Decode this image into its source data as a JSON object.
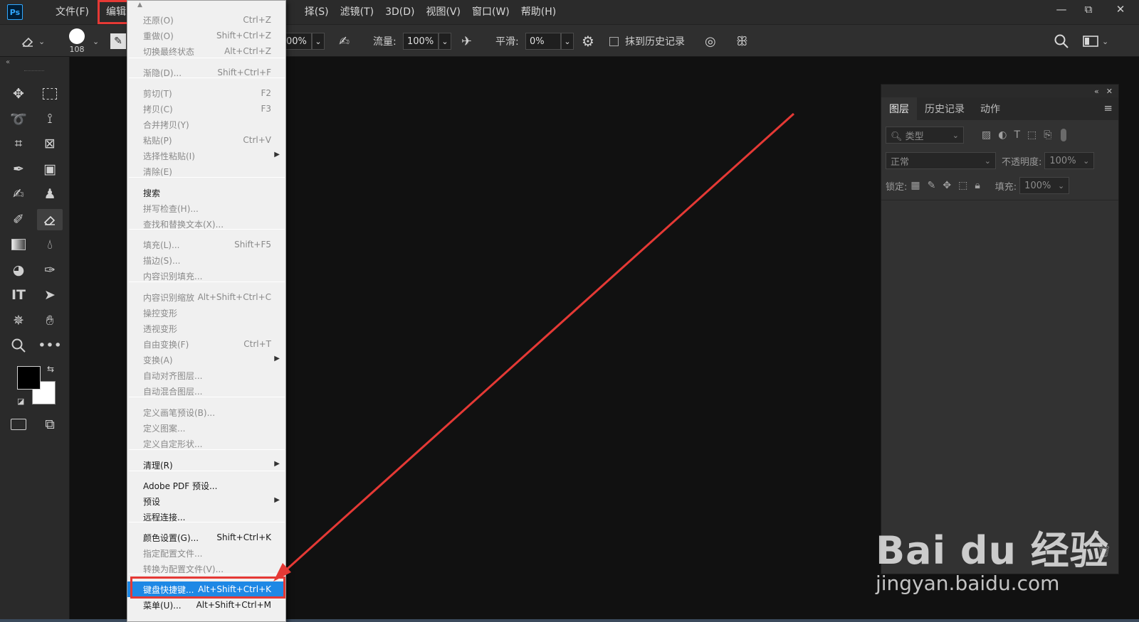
{
  "menubar": {
    "logo": "Ps",
    "items": [
      "文件(F)",
      "编辑(E)",
      "",
      "",
      "",
      "选择(S)",
      "滤镜(T)",
      "3D(D)",
      "视图(V)",
      "窗口(W)",
      "帮助(H)"
    ],
    "file": "文件(F)",
    "edit": "编辑(E)",
    "select_partial": "择(S)",
    "filter": "滤镜(T)",
    "threed": "3D(D)",
    "view": "视图(V)",
    "window": "窗口(W)",
    "help": "帮助(H)"
  },
  "window_controls": {
    "minimize": "—",
    "restore": "⧉",
    "close": "✕"
  },
  "options_bar": {
    "brush_size": "108",
    "opacity_partial": "00%",
    "flow_label": "流量:",
    "flow_value": "100%",
    "smoothing_label": "平滑:",
    "smoothing_value": "0%",
    "erase_to_history": "抹到历史记录"
  },
  "edit_menu": {
    "items": [
      {
        "label": "还原(O)",
        "shortcut": "Ctrl+Z",
        "disabled": true
      },
      {
        "label": "重做(O)",
        "shortcut": "Shift+Ctrl+Z",
        "disabled": true
      },
      {
        "label": "切换最终状态",
        "shortcut": "Alt+Ctrl+Z",
        "disabled": true
      },
      {
        "label": "渐隐(D)...",
        "shortcut": "Shift+Ctrl+F",
        "disabled": true
      },
      {
        "label": "剪切(T)",
        "shortcut": "F2",
        "disabled": true
      },
      {
        "label": "拷贝(C)",
        "shortcut": "F3",
        "disabled": true
      },
      {
        "label": "合并拷贝(Y)",
        "shortcut": "",
        "disabled": true
      },
      {
        "label": "粘贴(P)",
        "shortcut": "Ctrl+V",
        "disabled": true
      },
      {
        "label": "选择性粘贴(I)",
        "shortcut": "",
        "disabled": true
      },
      {
        "label": "清除(E)",
        "shortcut": "",
        "disabled": true
      },
      {
        "label": "搜索",
        "shortcut": "",
        "disabled": false
      },
      {
        "label": "拼写检查(H)...",
        "shortcut": "",
        "disabled": true
      },
      {
        "label": "查找和替换文本(X)...",
        "shortcut": "",
        "disabled": true
      },
      {
        "label": "填充(L)...",
        "shortcut": "Shift+F5",
        "disabled": true
      },
      {
        "label": "描边(S)...",
        "shortcut": "",
        "disabled": true
      },
      {
        "label": "内容识别填充...",
        "shortcut": "",
        "disabled": true
      },
      {
        "label": "内容识别缩放",
        "shortcut": "Alt+Shift+Ctrl+C",
        "disabled": true
      },
      {
        "label": "操控变形",
        "shortcut": "",
        "disabled": true
      },
      {
        "label": "透视变形",
        "shortcut": "",
        "disabled": true
      },
      {
        "label": "自由变换(F)",
        "shortcut": "Ctrl+T",
        "disabled": true
      },
      {
        "label": "变换(A)",
        "shortcut": "",
        "disabled": true
      },
      {
        "label": "自动对齐图层...",
        "shortcut": "",
        "disabled": true
      },
      {
        "label": "自动混合图层...",
        "shortcut": "",
        "disabled": true
      },
      {
        "label": "定义画笔预设(B)...",
        "shortcut": "",
        "disabled": true
      },
      {
        "label": "定义图案...",
        "shortcut": "",
        "disabled": true
      },
      {
        "label": "定义自定形状...",
        "shortcut": "",
        "disabled": true
      },
      {
        "label": "清理(R)",
        "shortcut": "",
        "disabled": false
      },
      {
        "label": "Adobe PDF 预设...",
        "shortcut": "",
        "disabled": false
      },
      {
        "label": "预设",
        "shortcut": "",
        "disabled": false
      },
      {
        "label": "远程连接...",
        "shortcut": "",
        "disabled": false
      },
      {
        "label": "颜色设置(G)...",
        "shortcut": "Shift+Ctrl+K",
        "disabled": false
      },
      {
        "label": "指定配置文件...",
        "shortcut": "",
        "disabled": true
      },
      {
        "label": "转换为配置文件(V)...",
        "shortcut": "",
        "disabled": true
      },
      {
        "label": "键盘快捷键...",
        "shortcut": "Alt+Shift+Ctrl+K",
        "disabled": false
      },
      {
        "label": "菜单(U)...",
        "shortcut": "Alt+Shift+Ctrl+M",
        "disabled": false
      }
    ]
  },
  "layers_panel": {
    "tabs": [
      "图层",
      "历史记录",
      "动作"
    ],
    "filter_placeholder": "类型",
    "blend_mode": "正常",
    "opacity_label": "不透明度:",
    "opacity_value": "100%",
    "lock_label": "锁定:",
    "fill_label": "填充:",
    "fill_value": "100%"
  },
  "watermark": {
    "text": "Bai du 经验",
    "url": "jingyan.baidu.com"
  },
  "annotation": {
    "highlight_color": "#e53935",
    "arrow_color": "#e53935",
    "menu_highlight": "#1e88e5"
  }
}
